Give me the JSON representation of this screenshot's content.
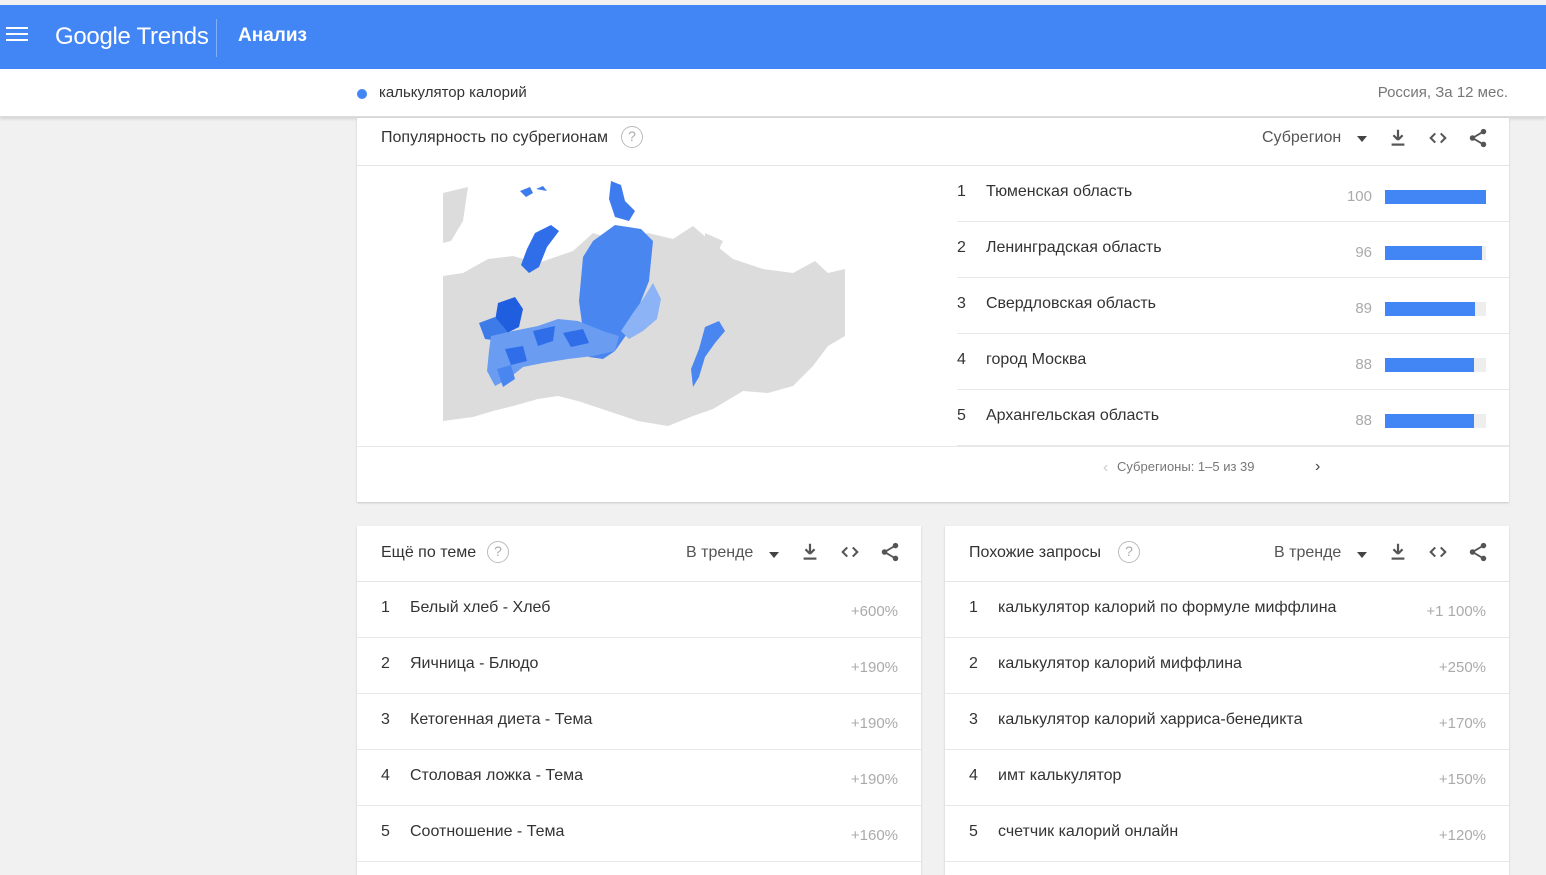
{
  "header": {
    "logo_google": "Google",
    "logo_trends": "Trends",
    "section": "Анализ"
  },
  "query": {
    "term": "калькулятор калорий",
    "scope": "Россия, За 12 мес.",
    "color": "#4285f4"
  },
  "subregions": {
    "title": "Популярность по субрегионам",
    "help": "?",
    "dropdown": "Субрегион",
    "icons": [
      "download-icon",
      "embed-icon",
      "share-icon"
    ],
    "rows": [
      {
        "rank": "1",
        "name": "Тюменская область",
        "value": "100",
        "level": 100
      },
      {
        "rank": "2",
        "name": "Ленинградская область",
        "value": "96",
        "level": 96
      },
      {
        "rank": "3",
        "name": "Свердловская область",
        "value": "89",
        "level": 89
      },
      {
        "rank": "4",
        "name": "город Москва",
        "value": "88",
        "level": 88
      },
      {
        "rank": "5",
        "name": "Архангельская область",
        "value": "88",
        "level": 88
      }
    ],
    "pagination": "Субрегионы: 1–5 из 39"
  },
  "topics": {
    "title": "Ещё по теме",
    "help": "?",
    "dropdown": "В тренде",
    "rows": [
      {
        "rank": "1",
        "name": "Белый хлеб - Хлеб",
        "value": "+600%"
      },
      {
        "rank": "2",
        "name": "Яичница - Блюдо",
        "value": "+190%"
      },
      {
        "rank": "3",
        "name": "Кетогенная диета - Тема",
        "value": "+190%"
      },
      {
        "rank": "4",
        "name": "Столовая ложка - Тема",
        "value": "+190%"
      },
      {
        "rank": "5",
        "name": "Соотношение - Тема",
        "value": "+160%"
      }
    ]
  },
  "queries": {
    "title": "Похожие запросы",
    "help": "?",
    "dropdown": "В тренде",
    "rows": [
      {
        "rank": "1",
        "name": "калькулятор калорий по формуле миффлина",
        "value": "+1 100%"
      },
      {
        "rank": "2",
        "name": "калькулятор калорий миффлина",
        "value": "+250%"
      },
      {
        "rank": "3",
        "name": "калькулятор калорий харриса-бенедикта",
        "value": "+170%"
      },
      {
        "rank": "4",
        "name": "имт калькулятор",
        "value": "+150%"
      },
      {
        "rank": "5",
        "name": "счетчик калорий онлайн",
        "value": "+120%"
      }
    ]
  }
}
